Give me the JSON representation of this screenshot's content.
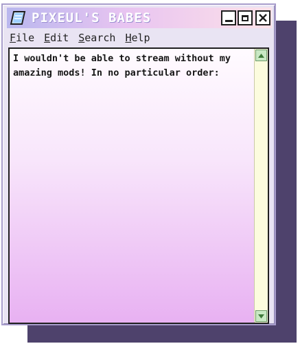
{
  "window": {
    "title": "PIXEUL'S BABES",
    "icon": "notepad-icon"
  },
  "controls": {
    "minimize": "minimize-icon",
    "maximize": "maximize-icon",
    "close": "close-icon"
  },
  "menu": {
    "items": [
      {
        "label": "File"
      },
      {
        "label": "Edit"
      },
      {
        "label": "Search"
      },
      {
        "label": "Help"
      }
    ]
  },
  "document": {
    "text": "I wouldn't be able to stream without my amazing mods! In no particular order:"
  },
  "colors": {
    "shadow": "#4e426c",
    "title_gradient": [
      "#b9b7ee",
      "#e8c4f1",
      "#fde1e8"
    ],
    "content_gradient": [
      "#fffbff",
      "#e8b1f2"
    ],
    "scrollbar_track": "#fcfcde",
    "scroll_button": "#c9e8c4"
  }
}
